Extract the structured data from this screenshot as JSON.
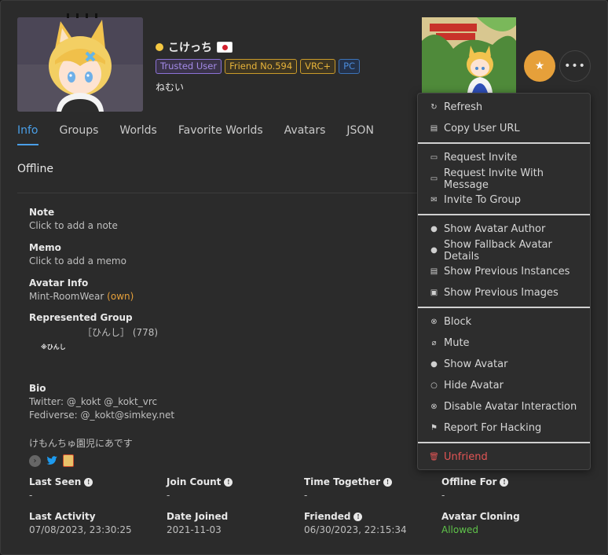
{
  "user": {
    "name": "こけっち",
    "status_color": "#f5c842",
    "status_text": "ねむい",
    "tags": [
      "Trusted User",
      "Friend No.594",
      "VRC+",
      "PC"
    ]
  },
  "tabs": [
    "Info",
    "Groups",
    "Worlds",
    "Favorite Worlds",
    "Avatars",
    "JSON"
  ],
  "active_tab": "Info",
  "location": "Offline",
  "note": {
    "label": "Note",
    "value": "Click to add a note"
  },
  "memo": {
    "label": "Memo",
    "value": "Click to add a memo"
  },
  "avatar_info": {
    "label": "Avatar Info",
    "value": "Mint-RoomWear",
    "own": "(own)"
  },
  "group": {
    "label": "Represented Group",
    "name": "［ひんし］",
    "members": "(778)",
    "badge_text": "※ひんし"
  },
  "bio": {
    "label": "Bio",
    "lines": [
      "Twitter: @_kokt @_kokt_vrc",
      "Fediverse: @_kokt@simkey.net",
      "",
      "けもんちゅ園児にあです"
    ]
  },
  "stats": [
    {
      "label": "Last Seen",
      "value": "-",
      "info": true
    },
    {
      "label": "Join Count",
      "value": "-",
      "info": true
    },
    {
      "label": "Time Together",
      "value": "-",
      "info": true
    },
    {
      "label": "Offline For",
      "value": "-",
      "info": true
    },
    {
      "label": "Last Activity",
      "value": "07/08/2023, 23:30:25",
      "info": false
    },
    {
      "label": "Date Joined",
      "value": "2021-11-03",
      "info": false
    },
    {
      "label": "Friended",
      "value": "06/30/2023, 22:15:34",
      "info": true
    },
    {
      "label": "Avatar Cloning",
      "value": "Allowed",
      "info": false
    }
  ],
  "menu": {
    "groups": [
      [
        {
          "label": "Refresh",
          "icon": "refresh-icon"
        },
        {
          "label": "Copy User URL",
          "icon": "clipboard-icon"
        }
      ],
      [
        {
          "label": "Request Invite",
          "icon": "message-icon"
        },
        {
          "label": "Request Invite With Message",
          "icon": "message-icon"
        },
        {
          "label": "Invite To Group",
          "icon": "mail-icon"
        }
      ],
      [
        {
          "label": "Show Avatar Author",
          "icon": "user-icon"
        },
        {
          "label": "Show Fallback Avatar Details",
          "icon": "user-icon"
        },
        {
          "label": "Show Previous Instances",
          "icon": "document-icon"
        },
        {
          "label": "Show Previous Images",
          "icon": "image-icon"
        }
      ],
      [
        {
          "label": "Block",
          "icon": "circle-x-icon"
        },
        {
          "label": "Mute",
          "icon": "mic-off-icon"
        },
        {
          "label": "Show Avatar",
          "icon": "user-icon"
        },
        {
          "label": "Hide Avatar",
          "icon": "user-outline-icon"
        },
        {
          "label": "Disable Avatar Interaction",
          "icon": "circle-x-icon"
        },
        {
          "label": "Report For Hacking",
          "icon": "flag-icon"
        }
      ],
      [
        {
          "label": "Unfriend",
          "icon": "trash-icon"
        }
      ]
    ]
  },
  "colors": {
    "accent": "#4a9fe8",
    "favorite": "#e6a03a",
    "danger": "#e25555",
    "allowed": "#5fc34a",
    "own": "#e6a03a"
  }
}
